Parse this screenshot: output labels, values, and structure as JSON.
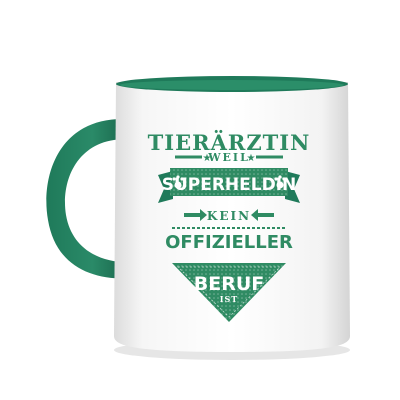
{
  "product": {
    "colors": {
      "body": "#ffffff",
      "accent": "#1f7a5a",
      "accent_dark": "#155c43",
      "print": "#2f8b63"
    },
    "print": {
      "line1": "TIERÄRZTIN",
      "line2": "WEIL",
      "line3": "SUPERHELDIN",
      "line4": "KEIN",
      "line5": "OFFIZIELLER",
      "line6": "BERUF",
      "line7": "IST"
    },
    "icons": [
      "paw-icon",
      "paw-icon",
      "arrow-right-icon",
      "arrow-left-icon",
      "star-icon",
      "star-icon"
    ]
  }
}
